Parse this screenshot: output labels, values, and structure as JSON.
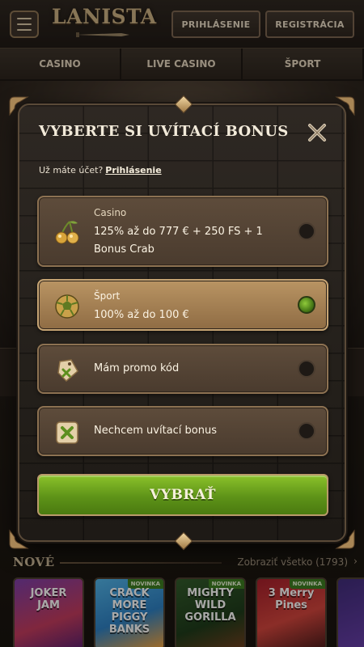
{
  "header": {
    "logo": "LANISTA",
    "login_label": "PRIHLÁSENIE",
    "register_label": "REGISTRÁCIA"
  },
  "nav": {
    "tabs": [
      "CASINO",
      "LIVE CASINO",
      "ŠPORT"
    ]
  },
  "modal": {
    "title": "VYBERTE SI UVÍTACÍ BONUS",
    "account_prompt": "Už máte účet?",
    "account_link": "Prihlásenie",
    "options": [
      {
        "category": "Casino",
        "text": "125% až do 777 € + 250 FS + 1 Bonus Crab",
        "icon": "cherries-icon",
        "selected": false
      },
      {
        "category": "Šport",
        "text": "100% až do 100 €",
        "icon": "soccer-ball-icon",
        "selected": true
      },
      {
        "category": "",
        "text": "Mám promo kód",
        "icon": "promo-tag-icon",
        "selected": false
      },
      {
        "category": "",
        "text": "Nechcem uvítací bonus",
        "icon": "no-bonus-icon",
        "selected": false
      }
    ],
    "choose_label": "VYBRAŤ"
  },
  "new_games": {
    "title": "NOVÉ",
    "show_all": "Zobraziť všetko (1793)",
    "games": [
      {
        "name": "JOKER JAM",
        "badge": ""
      },
      {
        "name": "CRACK MORE PIGGY BANKS",
        "badge": "NOVINKA"
      },
      {
        "name": "MIGHTY WILD GORILLA",
        "badge": "NOVINKA"
      },
      {
        "name": "3 Merry Pines",
        "badge": "NOVINKA"
      },
      {
        "name": "",
        "badge": ""
      }
    ]
  },
  "colors": {
    "accent_green": "#6fa61f",
    "selected_option": "#b99463",
    "frame_gold": "#8d7252"
  }
}
